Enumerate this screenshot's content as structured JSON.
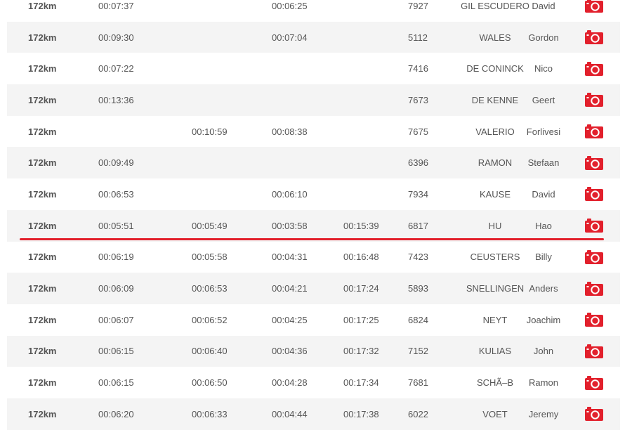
{
  "colors": {
    "accent": "#e2202c",
    "row_alt": "#f4f4f4",
    "text": "#555555"
  },
  "camera_icon": "camera-icon",
  "rows": [
    {
      "dist": "172km",
      "t1": "00:07:37",
      "t2": "",
      "t3": "00:06:25",
      "t4": "",
      "bib": "7927",
      "last": "GIL ESCUDERO",
      "first": "David"
    },
    {
      "dist": "172km",
      "t1": "00:09:30",
      "t2": "",
      "t3": "00:07:04",
      "t4": "",
      "bib": "5112",
      "last": "WALES",
      "first": "Gordon"
    },
    {
      "dist": "172km",
      "t1": "00:07:22",
      "t2": "",
      "t3": "",
      "t4": "",
      "bib": "7416",
      "last": "DE CONINCK",
      "first": "Nico"
    },
    {
      "dist": "172km",
      "t1": "00:13:36",
      "t2": "",
      "t3": "",
      "t4": "",
      "bib": "7673",
      "last": "DE KENNE",
      "first": "Geert"
    },
    {
      "dist": "172km",
      "t1": "",
      "t2": "00:10:59",
      "t3": "00:08:38",
      "t4": "",
      "bib": "7675",
      "last": "VALERIO",
      "first": "Forlivesi"
    },
    {
      "dist": "172km",
      "t1": "00:09:49",
      "t2": "",
      "t3": "",
      "t4": "",
      "bib": "6396",
      "last": "RAMON",
      "first": "Stefaan"
    },
    {
      "dist": "172km",
      "t1": "00:06:53",
      "t2": "",
      "t3": "00:06:10",
      "t4": "",
      "bib": "7934",
      "last": "KAUSE",
      "first": "David"
    },
    {
      "dist": "172km",
      "t1": "00:05:51",
      "t2": "00:05:49",
      "t3": "00:03:58",
      "t4": "00:15:39",
      "bib": "6817",
      "last": "HU",
      "first": "Hao"
    },
    {
      "dist": "172km",
      "t1": "00:06:19",
      "t2": "00:05:58",
      "t3": "00:04:31",
      "t4": "00:16:48",
      "bib": "7423",
      "last": "CEUSTERS",
      "first": "Billy"
    },
    {
      "dist": "172km",
      "t1": "00:06:09",
      "t2": "00:06:53",
      "t3": "00:04:21",
      "t4": "00:17:24",
      "bib": "5893",
      "last": "SNELLINGEN",
      "first": "Anders"
    },
    {
      "dist": "172km",
      "t1": "00:06:07",
      "t2": "00:06:52",
      "t3": "00:04:25",
      "t4": "00:17:25",
      "bib": "6824",
      "last": "NEYT",
      "first": "Joachim"
    },
    {
      "dist": "172km",
      "t1": "00:06:15",
      "t2": "00:06:40",
      "t3": "00:04:36",
      "t4": "00:17:32",
      "bib": "7152",
      "last": "KULIAS",
      "first": "John"
    },
    {
      "dist": "172km",
      "t1": "00:06:15",
      "t2": "00:06:50",
      "t3": "00:04:28",
      "t4": "00:17:34",
      "bib": "7681",
      "last": "SCHÃ–B",
      "first": "Ramon"
    },
    {
      "dist": "172km",
      "t1": "00:06:20",
      "t2": "00:06:33",
      "t3": "00:04:44",
      "t4": "00:17:38",
      "bib": "6022",
      "last": "VOET",
      "first": "Jeremy"
    }
  ]
}
